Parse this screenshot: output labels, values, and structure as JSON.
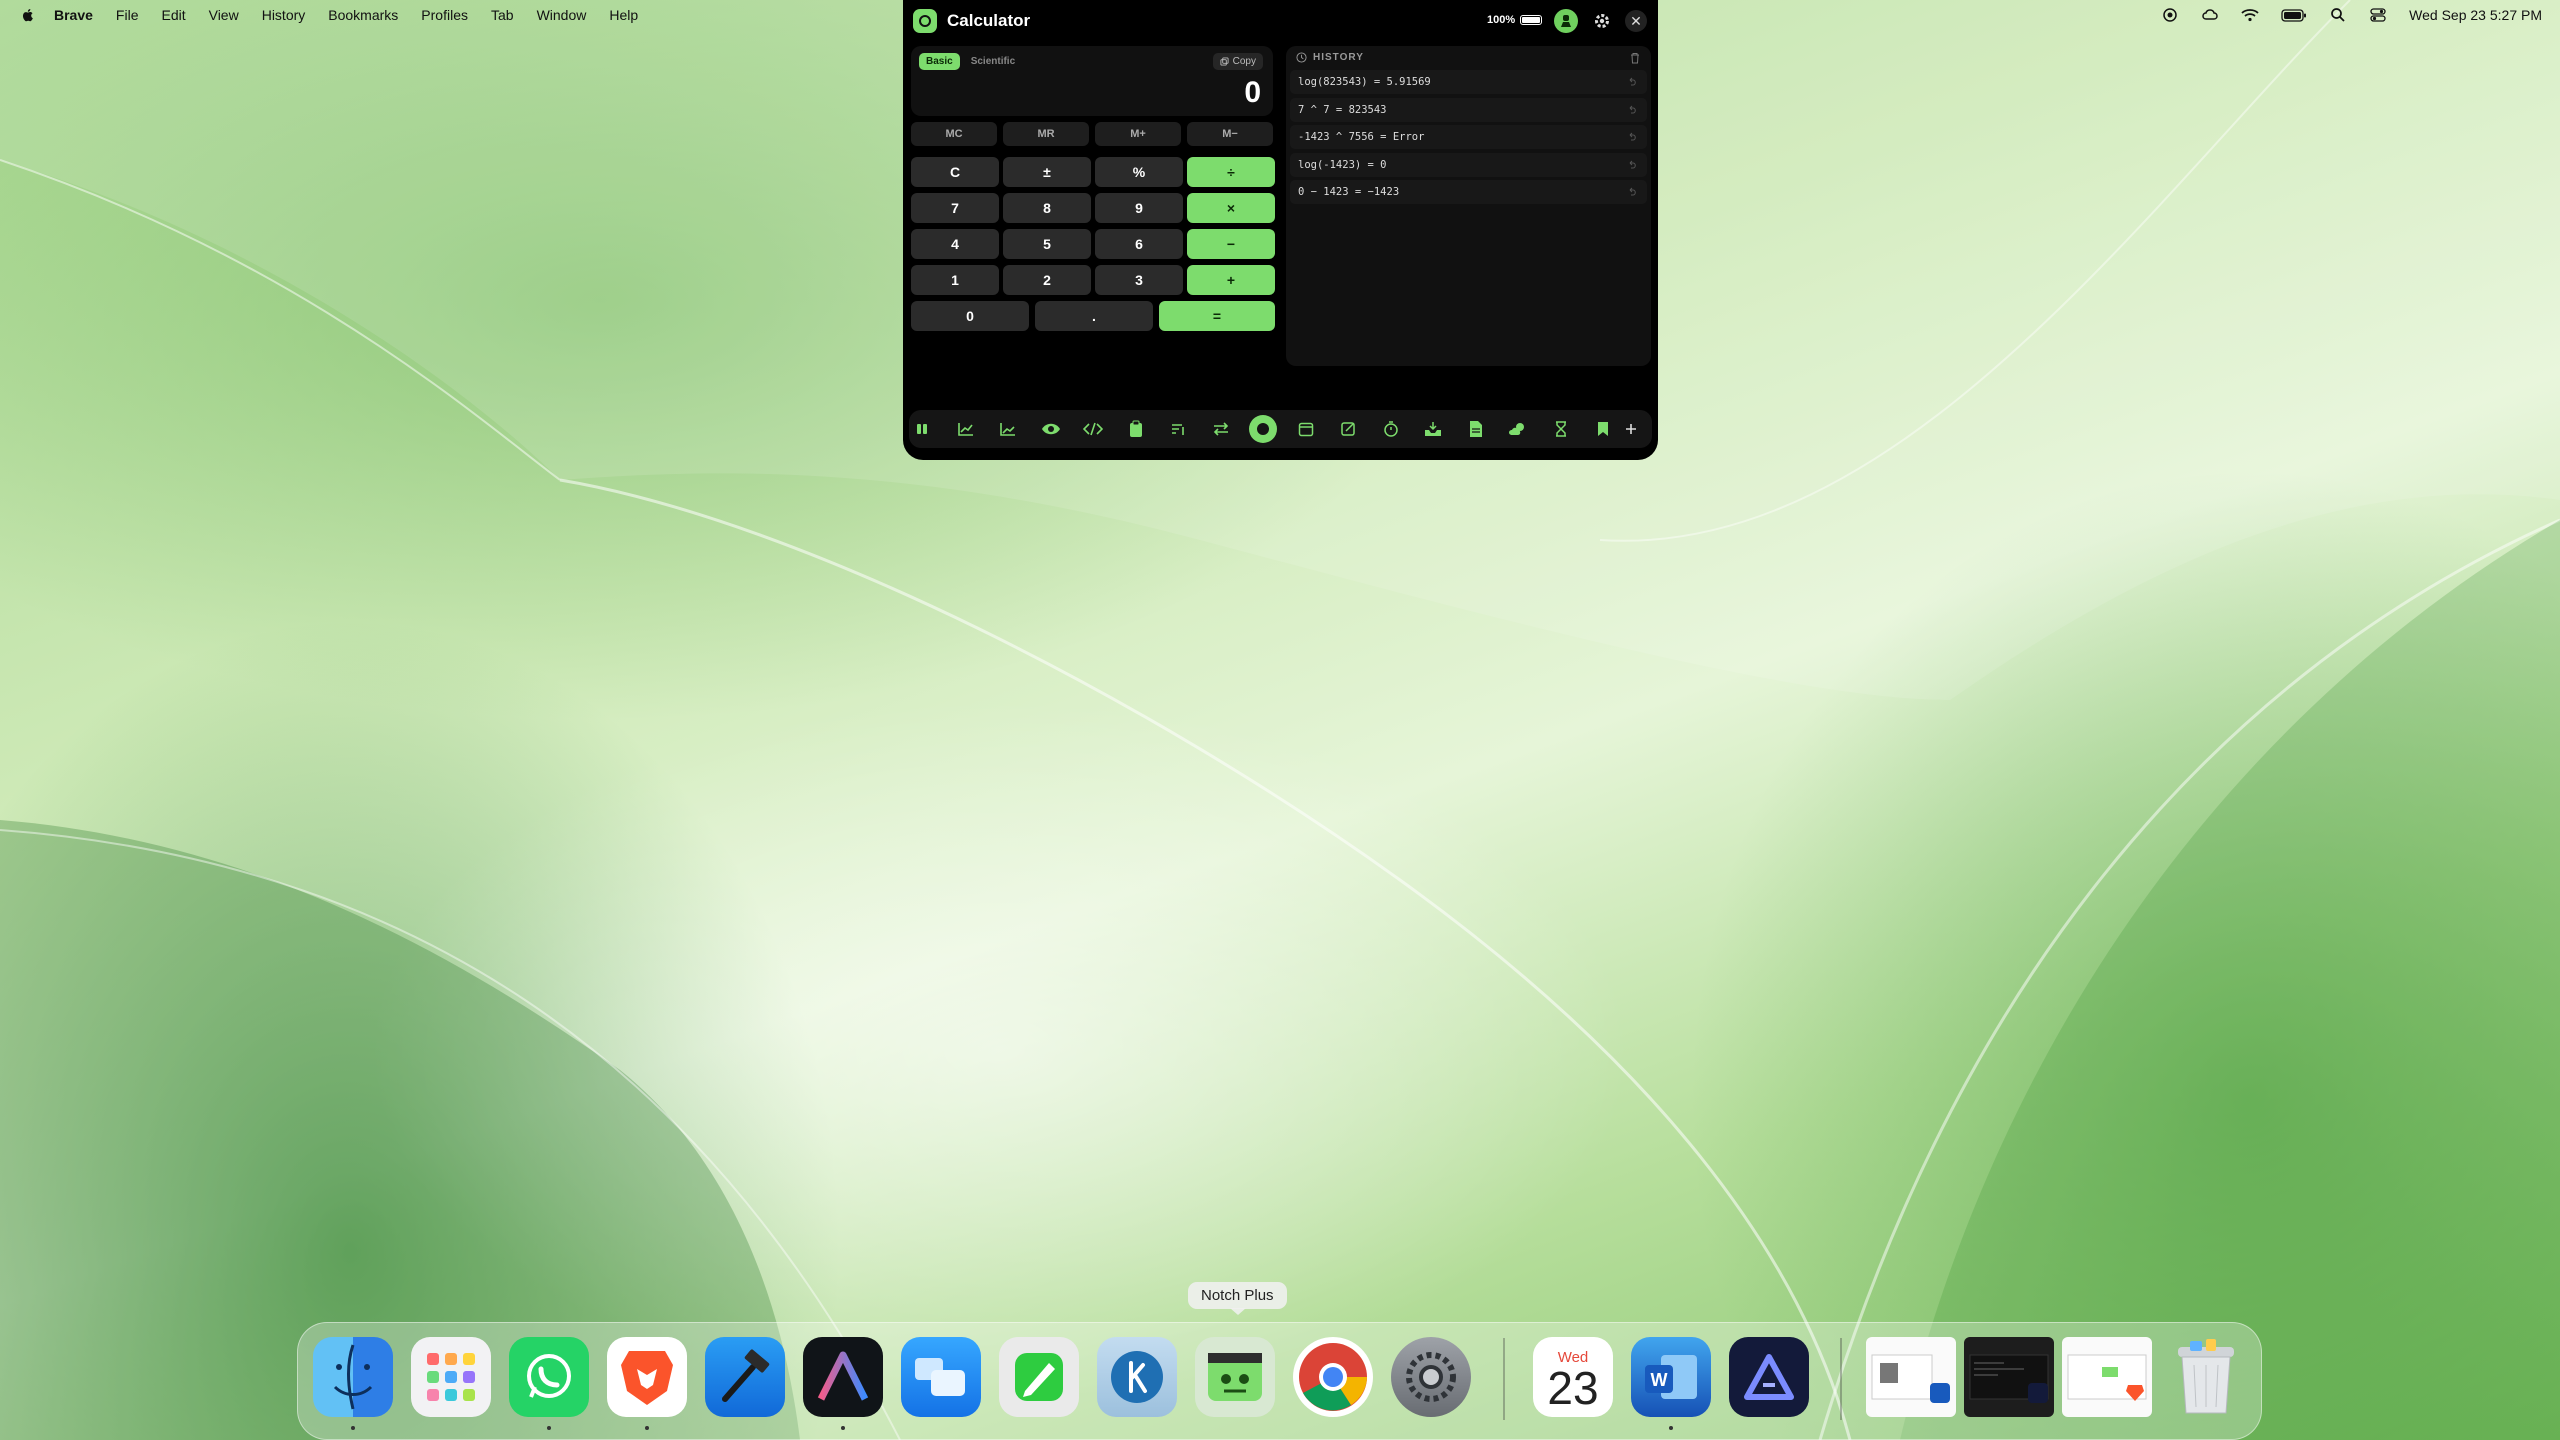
{
  "menubar": {
    "app_name": "Brave",
    "items": [
      "File",
      "Edit",
      "View",
      "History",
      "Bookmarks",
      "Profiles",
      "Tab",
      "Window",
      "Help"
    ],
    "clock": "Wed Sep 23  5:27 PM",
    "status_icons": [
      "notch-icon",
      "creative-cloud-icon",
      "wifi-icon",
      "battery-icon",
      "spotlight-icon",
      "control-center-icon"
    ]
  },
  "calculator": {
    "title": "Calculator",
    "battery_percent": "100%",
    "tabs": [
      "Basic",
      "Scientific"
    ],
    "active_tab": "Basic",
    "copy_label": "Copy",
    "display_value": "0",
    "memory_keys": [
      "MC",
      "MR",
      "M+",
      "M−"
    ],
    "rows": [
      [
        "C",
        "±",
        "%",
        "÷"
      ],
      [
        "7",
        "8",
        "9",
        "×"
      ],
      [
        "4",
        "5",
        "6",
        "−"
      ],
      [
        "1",
        "2",
        "3",
        "+"
      ],
      [
        "0",
        ".",
        "="
      ]
    ],
    "history_title": "HISTORY",
    "history": [
      "log(823543) = 5.91569",
      "7 ^ 7 = 823543",
      "-1423 ^ 7556 = Error",
      "log(-1423) = 0",
      "0 − 1423 = −1423"
    ],
    "toolbar_icons": [
      "sidebar-icon",
      "chart-icon",
      "trend-icon",
      "eye-icon",
      "code-icon",
      "clipboard-icon",
      "sort-icon",
      "convert-icon",
      "calculator-icon",
      "calendar-icon",
      "notes-icon",
      "timer-icon",
      "tray-icon",
      "document-icon",
      "weather-icon",
      "hourglass-icon",
      "bookmark-icon",
      "add-icon"
    ],
    "toolbar_active": "calculator-icon",
    "accent": "#7ddc6d"
  },
  "dock": {
    "tooltip": "Notch Plus",
    "calendar_day": "Wed",
    "calendar_date": "23",
    "apps": [
      "Finder",
      "Launchpad",
      "WhatsApp",
      "Brave",
      "Xcode",
      "Arc",
      "Screens",
      "Notes",
      "Klack",
      "Notch Plus",
      "Chrome",
      "System Settings",
      "Calendar",
      "Word",
      "Affinity"
    ]
  }
}
